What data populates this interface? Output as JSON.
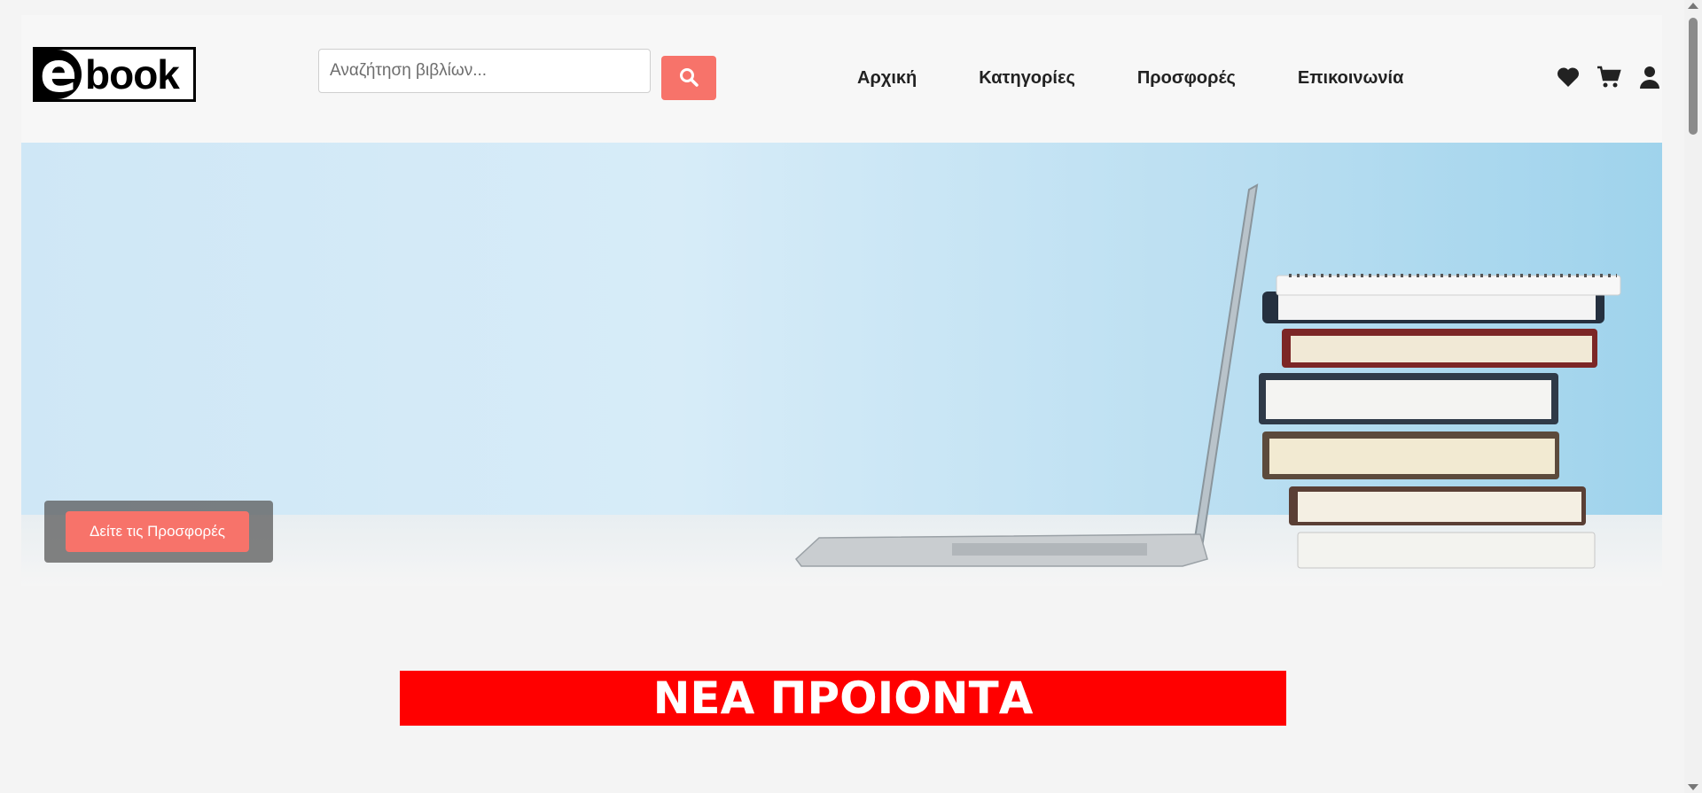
{
  "logo": {
    "letter": "e",
    "word": "book"
  },
  "search": {
    "placeholder": "Αναζήτηση βιβλίων..."
  },
  "nav": {
    "items": [
      {
        "label": "Αρχική"
      },
      {
        "label": "Κατηγορίες"
      },
      {
        "label": "Προσφορές"
      },
      {
        "label": "Επικοινωνία"
      }
    ]
  },
  "hero": {
    "cta_label": "Δείτε τις Προσφορές"
  },
  "sections": {
    "new_products_title": "ΝΕΑ ΠΡΟΙΟΝΤΑ"
  },
  "colors": {
    "accent": "#f7736a",
    "banner": "#ff0000",
    "header_bg": "#f7f7f7"
  },
  "icons": [
    "search-icon",
    "heart-icon",
    "cart-icon",
    "user-icon"
  ]
}
